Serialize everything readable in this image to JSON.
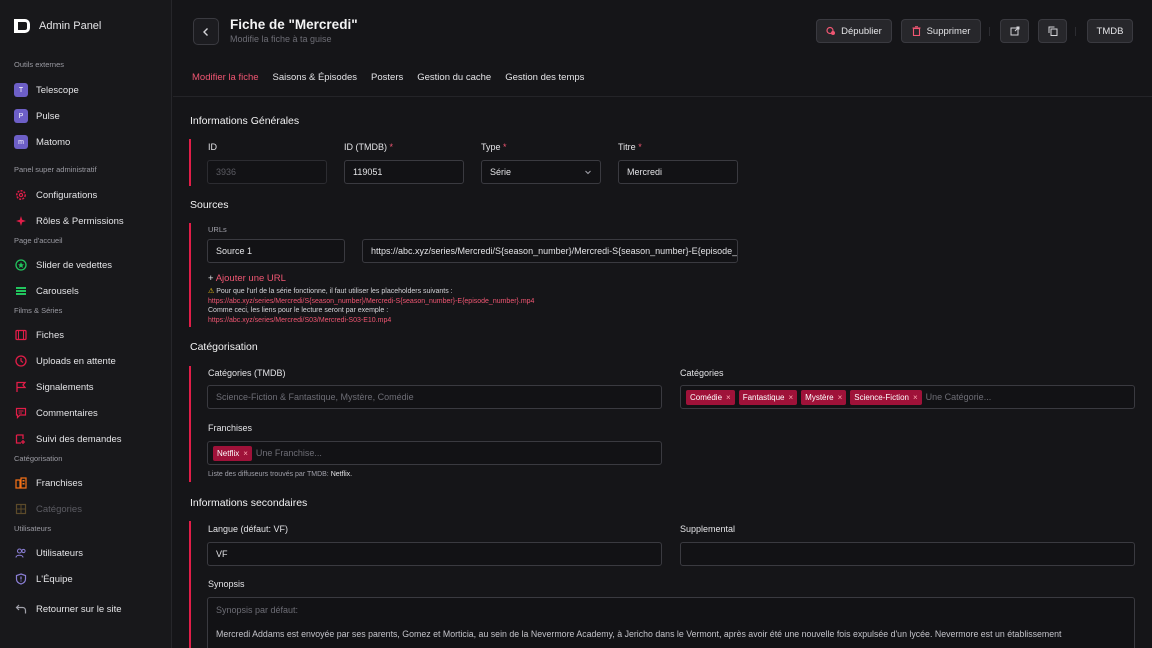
{
  "app": {
    "name": "Admin Panel"
  },
  "sidebar": {
    "groups": [
      {
        "title": "Outils externes",
        "items": [
          {
            "label": "Telescope",
            "icon": "telescope-icon"
          },
          {
            "label": "Pulse",
            "icon": "pulse-icon"
          },
          {
            "label": "Matomo",
            "icon": "matomo-icon"
          }
        ]
      },
      {
        "title": "Panel super administratif",
        "items": [
          {
            "label": "Configurations",
            "icon": "gear-icon"
          },
          {
            "label": "Rôles & Permissions",
            "icon": "sparkle-icon"
          }
        ]
      },
      {
        "title": "Page d'accueil",
        "items": [
          {
            "label": "Slider de vedettes",
            "icon": "star-badge-icon"
          },
          {
            "label": "Carousels",
            "icon": "stack-icon"
          }
        ]
      },
      {
        "title": "Films & Séries",
        "items": [
          {
            "label": "Fiches",
            "icon": "film-icon"
          },
          {
            "label": "Uploads en attente",
            "icon": "clock-icon"
          },
          {
            "label": "Signalements",
            "icon": "flag-icon"
          },
          {
            "label": "Commentaires",
            "icon": "comment-icon"
          },
          {
            "label": "Suivi des demandes",
            "icon": "request-icon"
          }
        ]
      },
      {
        "title": "Catégorisation",
        "items": [
          {
            "label": "Franchises",
            "icon": "building-icon"
          },
          {
            "label": "Catégories",
            "icon": "grid-icon"
          }
        ]
      },
      {
        "title": "Utilisateurs",
        "items": [
          {
            "label": "Utilisateurs",
            "icon": "users-icon"
          },
          {
            "label": "L'Équipe",
            "icon": "shield-icon"
          },
          {
            "label": "Retourner sur le site",
            "icon": "return-icon"
          }
        ]
      }
    ]
  },
  "header": {
    "title": "Fiche de \"Mercredi\"",
    "subtitle": "Modifie la fiche à ta guise",
    "unpublish_label": "Dépublier",
    "delete_label": "Supprimer",
    "tmdb_label": "TMDB"
  },
  "tabs": [
    "Modifier la fiche",
    "Saisons & Épisodes",
    "Posters",
    "Gestion du cache",
    "Gestion des temps"
  ],
  "general": {
    "title": "Informations Générales",
    "id_label": "ID",
    "id_value": "3936",
    "tmdb_label": "ID (TMDB)",
    "tmdb_value": "119051",
    "type_label": "Type",
    "type_value": "Série",
    "titre_label": "Titre",
    "titre_value": "Mercredi",
    "required_mark": "*"
  },
  "sources": {
    "title": "Sources",
    "urls_label": "URLs",
    "source_name": "Source 1",
    "source_url": "https://abc.xyz/series/Mercredi/S{season_number}/Mercredi-S{season_number}-E{episode_number}.mp4",
    "add_url": "Ajouter une URL",
    "add_prefix": "+",
    "warning_icon": "⚠",
    "help_line1": "Pour que l'url de la série fonctionne, il faut utiliser les placeholders suivants :",
    "help_url1": "https://abc.xyz/series/Mercredi/S{season_number}/Mercredi-S{season_number}-E{episode_number}.mp4",
    "help_line2": "Comme ceci, les liens pour le lecture seront par exemple :",
    "help_url2": "https://abc.xyz/series/Mercredi/S03/Mercredi-S03-E10.mp4"
  },
  "categorisation": {
    "title": "Catégorisation",
    "tmdb_cat_label": "Catégories (TMDB)",
    "tmdb_cat_placeholder": "Science-Fiction & Fantastique, Mystère, Comédie",
    "cat_label": "Catégories",
    "cat_chips": [
      "Comédie",
      "Fantastique",
      "Mystère",
      "Science-Fiction"
    ],
    "cat_placeholder": "Une Catégorie...",
    "franchise_label": "Franchises",
    "franchise_chips": [
      "Netflix"
    ],
    "franchise_placeholder": "Une Franchise...",
    "diffuseurs_text": "Liste des diffuseurs trouvés par TMDB:",
    "diffuseurs_value": "Netflix."
  },
  "secondary": {
    "title": "Informations secondaires",
    "langue_label": "Langue (défaut: VF)",
    "langue_value": "VF",
    "supp_label": "Supplemental",
    "synopsis_label": "Synopsis",
    "synopsis_placeholder": "Synopsis par défaut:",
    "synopsis_text": "Mercredi Addams est envoyée par ses parents, Gomez et Morticia, au sein de la Nevermore Academy, à Jericho dans le Vermont, après avoir été une nouvelle fois expulsée d'un lycée. Nevermore est un établissement"
  },
  "colors": {
    "accent": "#f05672",
    "chip": "#9f1239",
    "bg": "#151518"
  }
}
